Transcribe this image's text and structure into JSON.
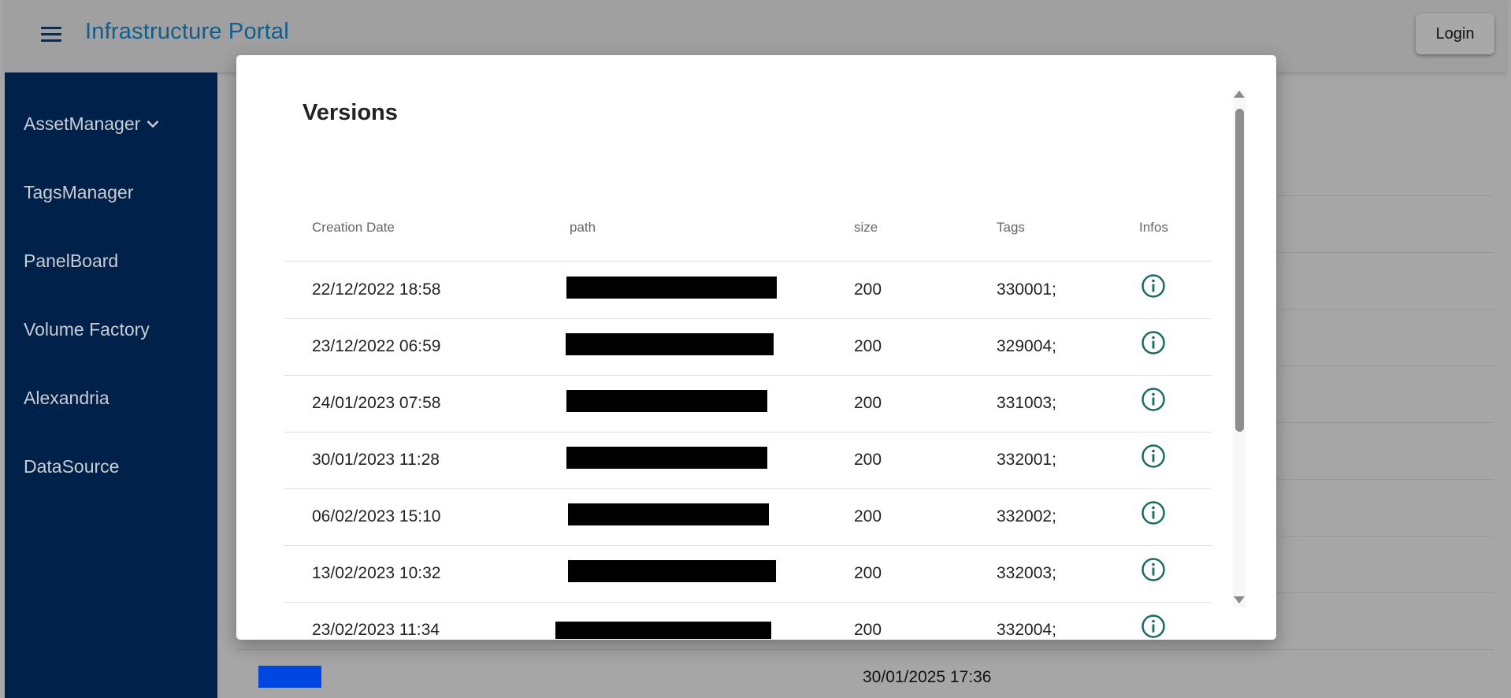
{
  "app": {
    "title": "Infrastructure Portal",
    "login_label": "Login"
  },
  "sidebar": {
    "items": [
      {
        "label": "AssetManager",
        "expandable": true
      },
      {
        "label": "TagsManager"
      },
      {
        "label": "PanelBoard"
      },
      {
        "label": "Volume Factory"
      },
      {
        "label": "Alexandria"
      },
      {
        "label": "DataSource"
      }
    ]
  },
  "background": {
    "date": "30/01/2025 17:36"
  },
  "dialog": {
    "title": "Versions",
    "columns": [
      "Creation Date",
      "path",
      "size",
      "Tags",
      "Infos"
    ],
    "rows": [
      {
        "date": "22/12/2022 18:58",
        "path": "[redacted]",
        "size": "200",
        "tags": "330001;"
      },
      {
        "date": "23/12/2022 06:59",
        "path": "[redacted]",
        "size": "200",
        "tags": "329004;"
      },
      {
        "date": "24/01/2023 07:58",
        "path": "[redacted]",
        "size": "200",
        "tags": "331003;"
      },
      {
        "date": "30/01/2023 11:28",
        "path": "[redacted]",
        "size": "200",
        "tags": "332001;"
      },
      {
        "date": "06/02/2023 15:10",
        "path": "[redacted]",
        "size": "200",
        "tags": "332002;"
      },
      {
        "date": "13/02/2023 10:32",
        "path": "[redacted]",
        "size": "200",
        "tags": "332003;"
      },
      {
        "date": "23/02/2023 11:34",
        "path": "[redacted]",
        "size": "200",
        "tags": "332004;"
      }
    ]
  },
  "colors": {
    "sidebar_bg": "#00214a",
    "title_blue": "#0f5e8f",
    "info_icon": "#1a6b63",
    "accent_blue": "#0046e0"
  },
  "icons": {
    "menu": "menu-icon",
    "expand": "chevron-down-icon",
    "info": "info-circle-icon"
  }
}
